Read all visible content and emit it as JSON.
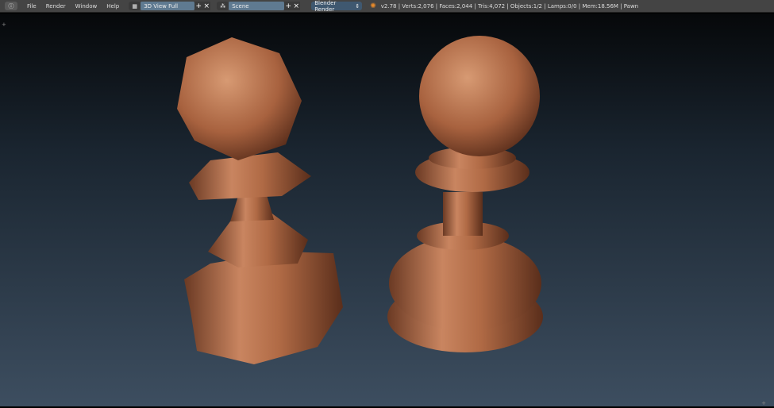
{
  "menu": {
    "items": [
      "File",
      "Render",
      "Window",
      "Help"
    ]
  },
  "screen_layout": {
    "value": "3D View Full"
  },
  "scene": {
    "value": "Scene"
  },
  "render_engine": {
    "value": "Blender Render"
  },
  "stats": "v2.78 | Verts:2,076 | Faces:2,044 | Tris:4,072 | Objects:1/2 | Lamps:0/0 | Mem:18.56M | Pawn",
  "colors": {
    "pawn": "#b5704a",
    "field": "#5f7a91",
    "topbar": "#444444"
  }
}
